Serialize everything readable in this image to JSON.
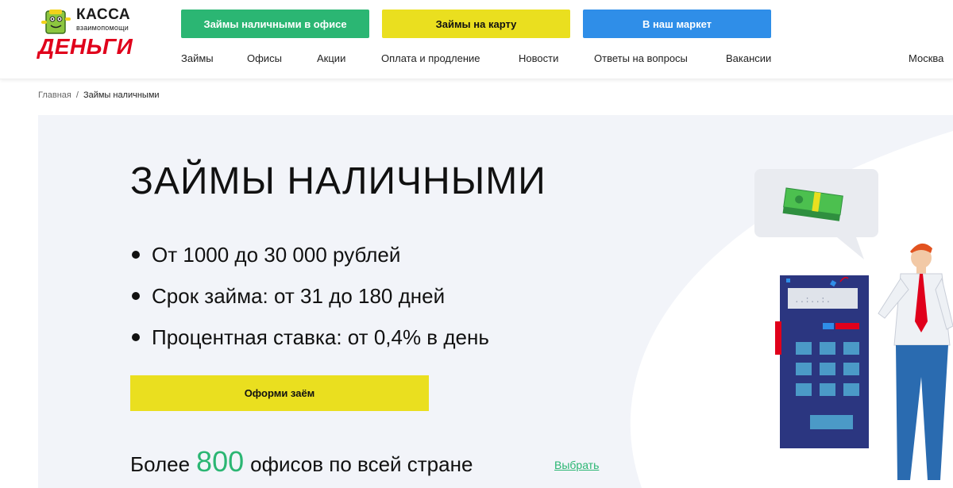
{
  "logo": {
    "top": "КАССА",
    "sub": "взаимопомощи",
    "main": "ДЕНЬГИ"
  },
  "top_buttons": {
    "office": "Займы наличными в офисе",
    "card": "Займы на карту",
    "market": "В наш маркет"
  },
  "nav": {
    "items": [
      "Займы",
      "Офисы",
      "Акции",
      "Оплата и продление",
      "Новости",
      "Ответы на вопросы",
      "Вакансии"
    ],
    "city": "Москва"
  },
  "breadcrumb": {
    "home": "Главная",
    "separator": "/",
    "current": "Займы наличными"
  },
  "hero": {
    "title": "ЗАЙМЫ НАЛИЧНЫМИ",
    "features": [
      "От 1000 до 30 000 рублей",
      "Срок займа: от 31 до 180 дней",
      "Процентная ставка: от 0,4% в день"
    ],
    "cta": "Оформи заём",
    "offices_prefix": "Более",
    "offices_count": "800",
    "offices_suffix": "офисов по всей стране",
    "choose_link": "Выбрать"
  },
  "colors": {
    "green": "#2bb673",
    "yellow": "#eadf1f",
    "blue": "#2f8ee8",
    "brand_red": "#e0001b",
    "hero_bg": "#f2f4f9"
  }
}
